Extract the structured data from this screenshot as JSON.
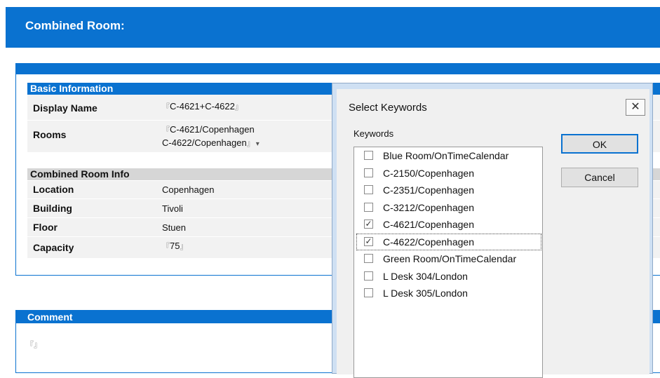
{
  "header": {
    "title": "Combined Room:"
  },
  "basic_info": {
    "heading": "Basic Information",
    "display_name": {
      "label": "Display Name",
      "value": "C-4621+C-4622"
    },
    "rooms": {
      "label": "Rooms",
      "value_line1": "C-4621/Copenhagen",
      "value_line2": "C-4622/Copenhagen"
    }
  },
  "combined_info": {
    "heading": "Combined Room Info",
    "location": {
      "label": "Location",
      "value": "Copenhagen"
    },
    "building": {
      "label": "Building",
      "value": "Tivoli"
    },
    "floor": {
      "label": "Floor",
      "value": "Stuen"
    },
    "capacity": {
      "label": "Capacity",
      "value": "75"
    }
  },
  "comment": {
    "heading": "Comment",
    "value": ""
  },
  "field_markers": {
    "open": "『",
    "close": "』",
    "dropdown": "▾"
  },
  "dialog": {
    "title": "Select Keywords",
    "close_glyph": "✕",
    "keywords_label": "Keywords",
    "ok_label": "OK",
    "cancel_label": "Cancel",
    "check_glyph": "✓",
    "items": [
      {
        "label": "Blue Room/OnTimeCalendar",
        "checked": false
      },
      {
        "label": "C-2150/Copenhagen",
        "checked": false
      },
      {
        "label": "C-2351/Copenhagen",
        "checked": false
      },
      {
        "label": "C-3212/Copenhagen",
        "checked": false
      },
      {
        "label": "C-4621/Copenhagen",
        "checked": true
      },
      {
        "label": "C-4622/Copenhagen",
        "checked": true
      },
      {
        "label": "Green Room/OnTimeCalendar",
        "checked": false
      },
      {
        "label": "L Desk 304/London",
        "checked": false
      },
      {
        "label": "L Desk 305/London",
        "checked": false
      }
    ]
  },
  "colors": {
    "accent": "#0a72d0",
    "row_bg": "#f2f2f2",
    "section_gray": "#d6d6d6"
  }
}
